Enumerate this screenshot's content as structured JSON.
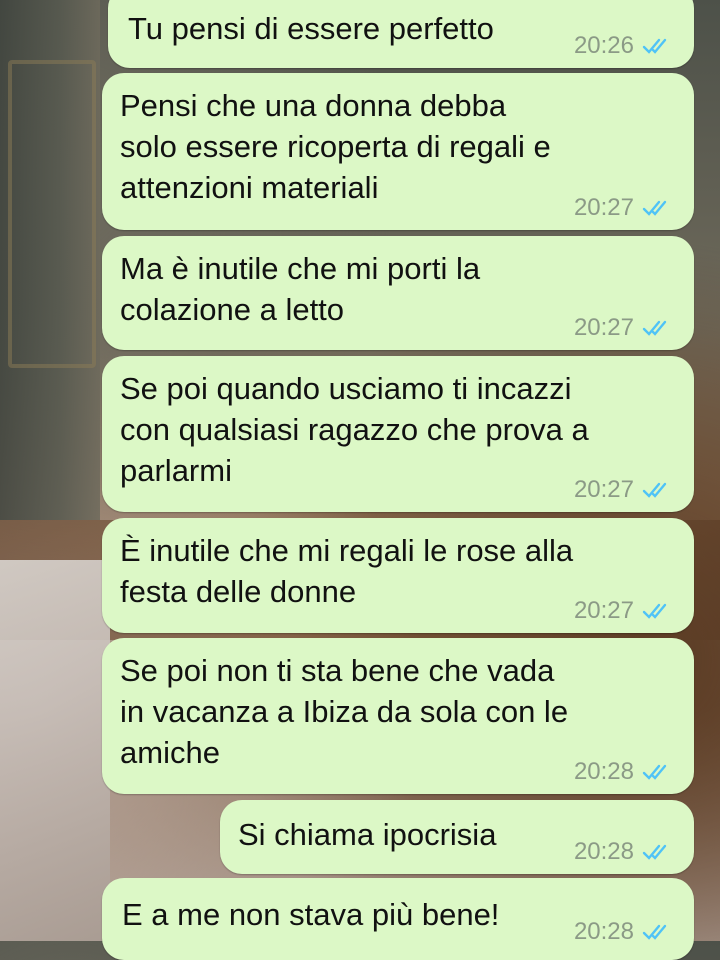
{
  "colors": {
    "bubble_background": "#dcf8c6",
    "time_color": "#8b9a86",
    "read_ticks": "#4fc3f7"
  },
  "messages": [
    {
      "text": "Tu pensi di essere perfetto",
      "time": "20:26",
      "status": "read"
    },
    {
      "text": "Pensi che una donna debba\nsolo essere ricoperta di regali e\nattenzioni materiali",
      "time": "20:27",
      "status": "read"
    },
    {
      "text": "Ma è inutile che mi porti la\ncolazione a letto",
      "time": "20:27",
      "status": "read"
    },
    {
      "text": "Se poi quando usciamo ti incazzi\ncon qualsiasi ragazzo che prova a\nparlarmi",
      "time": "20:27",
      "status": "read"
    },
    {
      "text": "È inutile che mi regali le rose alla\nfesta delle donne",
      "time": "20:27",
      "status": "read"
    },
    {
      "text": "Se poi non ti sta bene che vada\nin vacanza a Ibiza da sola con le\namiche",
      "time": "20:28",
      "status": "read"
    },
    {
      "text": "Si chiama ipocrisia",
      "time": "20:28",
      "status": "read"
    },
    {
      "text": "E a me non stava più bene!",
      "time": "20:28",
      "status": "read"
    }
  ],
  "icons": {
    "read_receipt": "double-check-icon"
  }
}
